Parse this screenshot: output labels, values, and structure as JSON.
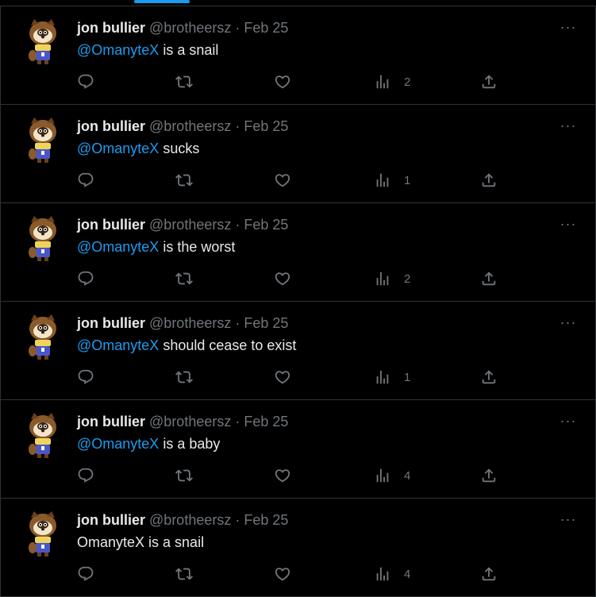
{
  "tweets": [
    {
      "name": "jon bullier",
      "handle": "@brotheersz",
      "separator": "·",
      "date": "Feb 25",
      "mention": "@OmanyteX",
      "text": " is a snail",
      "views": "2",
      "more": "···"
    },
    {
      "name": "jon bullier",
      "handle": "@brotheersz",
      "separator": "·",
      "date": "Feb 25",
      "mention": "@OmanyteX",
      "text": " sucks",
      "views": "1",
      "more": "···"
    },
    {
      "name": "jon bullier",
      "handle": "@brotheersz",
      "separator": "·",
      "date": "Feb 25",
      "mention": "@OmanyteX",
      "text": " is the worst",
      "views": "2",
      "more": "···"
    },
    {
      "name": "jon bullier",
      "handle": "@brotheersz",
      "separator": "·",
      "date": "Feb 25",
      "mention": "@OmanyteX",
      "text": " should cease to exist",
      "views": "1",
      "more": "···"
    },
    {
      "name": "jon bullier",
      "handle": "@brotheersz",
      "separator": "·",
      "date": "Feb 25",
      "mention": "@OmanyteX",
      "text": " is a baby",
      "views": "4",
      "more": "···"
    },
    {
      "name": "jon bullier",
      "handle": "@brotheersz",
      "separator": "·",
      "date": "Feb 25",
      "mention": "",
      "text": "OmanyteX is a snail",
      "views": "4",
      "more": "···"
    }
  ],
  "icons": {
    "avatar": "tanuki-avatar-icon",
    "reply": "reply-icon",
    "retweet": "retweet-icon",
    "like": "heart-icon",
    "views": "views-chart-icon",
    "share": "share-icon",
    "more": "more-icon"
  },
  "colors": {
    "background": "#000000",
    "text": "#e7e9ea",
    "muted": "#71767b",
    "accent": "#1d9bf0",
    "border": "#2f3336"
  }
}
